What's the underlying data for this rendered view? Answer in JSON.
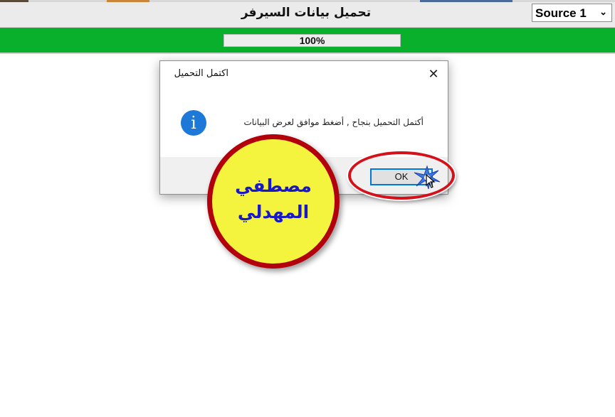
{
  "header": {
    "title": "تحميل بيانات السيرفر",
    "source_select": {
      "value": "Source 1"
    }
  },
  "progress": {
    "label": "100%",
    "value": 1.0
  },
  "dialog": {
    "title": "اكتمل التحميل",
    "message": "أكتمل التحميل بنجاح , أضغط موافق لعرض البيانات",
    "ok_label": "OK",
    "close_symbol": "✕",
    "icon": "info-icon"
  },
  "badge": {
    "line1": "مصطفي",
    "line2": "المهدلي"
  },
  "colors": {
    "progress_band": "#08b02c",
    "badge_fill": "#f4f33e",
    "badge_border": "#b3000d",
    "badge_text": "#1818c6",
    "highlight_ring": "#d4111b",
    "ok_border": "#0078d7",
    "info_icon": "#1e78d7"
  }
}
